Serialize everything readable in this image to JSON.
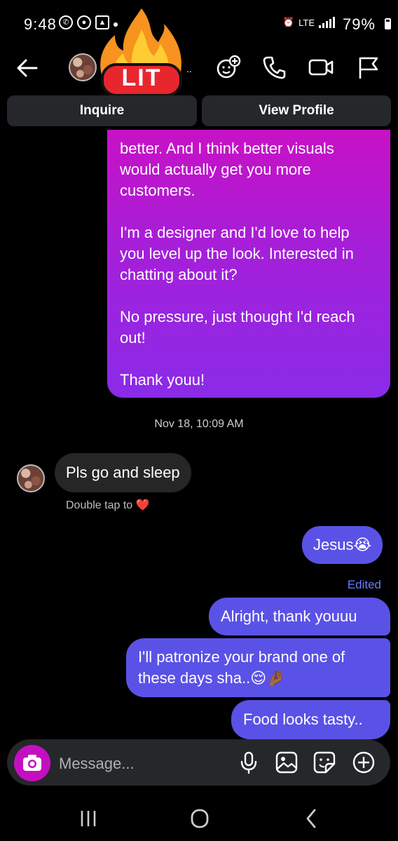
{
  "status_bar": {
    "time": "9:48",
    "battery_pct": "79%",
    "network": "LTE"
  },
  "header": {
    "sticker_text": "LIT",
    "ellipsis": "..",
    "buttons": {
      "inquire": "Inquire",
      "view_profile": "View Profile"
    }
  },
  "messages": {
    "outgoing_long": [
      "better. And I think better visuals would actually get you more customers.",
      "I'm a designer and I'd love to help you level up the look. Interested in chatting about it?",
      "No pressure, just thought I'd reach out!",
      "Thank youu!"
    ],
    "timestamp": "Nov 18, 10:09 AM",
    "incoming": "Pls go and sleep",
    "double_tap": "Double tap to",
    "reply1": "Jesus😭",
    "edited_label": "Edited",
    "reply2": "Alright, thank youuu",
    "reply3": "I'll patronize your brand one of these days sha..😌🤌🏾",
    "reply4": "Food looks tasty.."
  },
  "composer": {
    "placeholder": "Message..."
  },
  "colors": {
    "accent": "#5a52e6",
    "gradient_top": "#c811c5",
    "gradient_bottom": "#8a2be8",
    "camera": "#c40fc1"
  }
}
